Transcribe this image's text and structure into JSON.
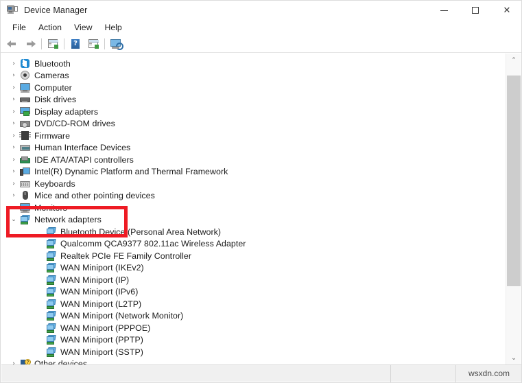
{
  "window": {
    "title": "Device Manager",
    "icon": "device-manager-icon",
    "controls": {
      "minimize": "─",
      "maximize": "□",
      "close": "✕"
    }
  },
  "menubar": {
    "items": [
      {
        "label": "File",
        "name": "menu-file"
      },
      {
        "label": "Action",
        "name": "menu-action"
      },
      {
        "label": "View",
        "name": "menu-view"
      },
      {
        "label": "Help",
        "name": "menu-help"
      }
    ]
  },
  "toolbar": {
    "buttons": [
      {
        "name": "back-button",
        "icon": "arrow-left-icon",
        "tooltip": "Back"
      },
      {
        "name": "forward-button",
        "icon": "arrow-right-icon",
        "tooltip": "Forward"
      },
      {
        "name": "properties-button",
        "icon": "properties-icon",
        "tooltip": "Properties"
      },
      {
        "name": "help-button",
        "icon": "help-question-icon",
        "tooltip": "Help"
      },
      {
        "name": "update-driver-button",
        "icon": "update-driver-icon",
        "tooltip": "Update driver"
      },
      {
        "name": "scan-hardware-button",
        "icon": "scan-hardware-icon",
        "tooltip": "Scan for hardware changes"
      }
    ]
  },
  "tree": {
    "rows": [
      {
        "label": "Bluetooth",
        "icon": "bluetooth-icon",
        "indent": 0,
        "chevron": "›",
        "expanded": false
      },
      {
        "label": "Cameras",
        "icon": "camera-icon",
        "indent": 0,
        "chevron": "›",
        "expanded": false
      },
      {
        "label": "Computer",
        "icon": "computer-icon",
        "indent": 0,
        "chevron": "›",
        "expanded": false
      },
      {
        "label": "Disk drives",
        "icon": "disk-drive-icon",
        "indent": 0,
        "chevron": "›",
        "expanded": false
      },
      {
        "label": "Display adapters",
        "icon": "display-adapter-icon",
        "indent": 0,
        "chevron": "›",
        "expanded": false
      },
      {
        "label": "DVD/CD-ROM drives",
        "icon": "dvd-drive-icon",
        "indent": 0,
        "chevron": "›",
        "expanded": false
      },
      {
        "label": "Firmware",
        "icon": "firmware-icon",
        "indent": 0,
        "chevron": "›",
        "expanded": false
      },
      {
        "label": "Human Interface Devices",
        "icon": "hid-icon",
        "indent": 0,
        "chevron": "›",
        "expanded": false
      },
      {
        "label": "IDE ATA/ATAPI controllers",
        "icon": "ide-controller-icon",
        "indent": 0,
        "chevron": "›",
        "expanded": false
      },
      {
        "label": "Intel(R) Dynamic Platform and Thermal Framework",
        "icon": "intel-platform-icon",
        "indent": 0,
        "chevron": "›",
        "expanded": false
      },
      {
        "label": "Keyboards",
        "icon": "keyboard-icon",
        "indent": 0,
        "chevron": "›",
        "expanded": false
      },
      {
        "label": "Mice and other pointing devices",
        "icon": "mouse-icon",
        "indent": 0,
        "chevron": "›",
        "expanded": false
      },
      {
        "label": "Monitors",
        "icon": "monitor-icon",
        "indent": 0,
        "chevron": "›",
        "expanded": false
      },
      {
        "label": "Network adapters",
        "icon": "network-adapter-icon",
        "indent": 0,
        "chevron": "⌄",
        "expanded": true
      },
      {
        "label": "Bluetooth Device (Personal Area Network)",
        "icon": "network-adapter-icon",
        "indent": 1,
        "chevron": "",
        "expanded": false
      },
      {
        "label": "Qualcomm QCA9377 802.11ac Wireless Adapter",
        "icon": "network-adapter-icon",
        "indent": 1,
        "chevron": "",
        "expanded": false
      },
      {
        "label": "Realtek PCIe FE Family Controller",
        "icon": "network-adapter-icon",
        "indent": 1,
        "chevron": "",
        "expanded": false
      },
      {
        "label": "WAN Miniport (IKEv2)",
        "icon": "network-adapter-icon",
        "indent": 1,
        "chevron": "",
        "expanded": false
      },
      {
        "label": "WAN Miniport (IP)",
        "icon": "network-adapter-icon",
        "indent": 1,
        "chevron": "",
        "expanded": false
      },
      {
        "label": "WAN Miniport (IPv6)",
        "icon": "network-adapter-icon",
        "indent": 1,
        "chevron": "",
        "expanded": false
      },
      {
        "label": "WAN Miniport (L2TP)",
        "icon": "network-adapter-icon",
        "indent": 1,
        "chevron": "",
        "expanded": false
      },
      {
        "label": "WAN Miniport (Network Monitor)",
        "icon": "network-adapter-icon",
        "indent": 1,
        "chevron": "",
        "expanded": false
      },
      {
        "label": "WAN Miniport (PPPOE)",
        "icon": "network-adapter-icon",
        "indent": 1,
        "chevron": "",
        "expanded": false
      },
      {
        "label": "WAN Miniport (PPTP)",
        "icon": "network-adapter-icon",
        "indent": 1,
        "chevron": "",
        "expanded": false
      },
      {
        "label": "WAN Miniport (SSTP)",
        "icon": "network-adapter-icon",
        "indent": 1,
        "chevron": "",
        "expanded": false
      },
      {
        "label": "Other devices",
        "icon": "other-devices-icon",
        "indent": 0,
        "chevron": "›",
        "expanded": false
      }
    ]
  },
  "annotation": {
    "name": "red-highlight-box",
    "color": "#ee1b24",
    "targets": "Network adapters"
  },
  "scrollbar": {
    "up_arrow": "⌃",
    "down_arrow": "⌄"
  },
  "statusbar": {
    "watermark": "wsxdn.com"
  }
}
